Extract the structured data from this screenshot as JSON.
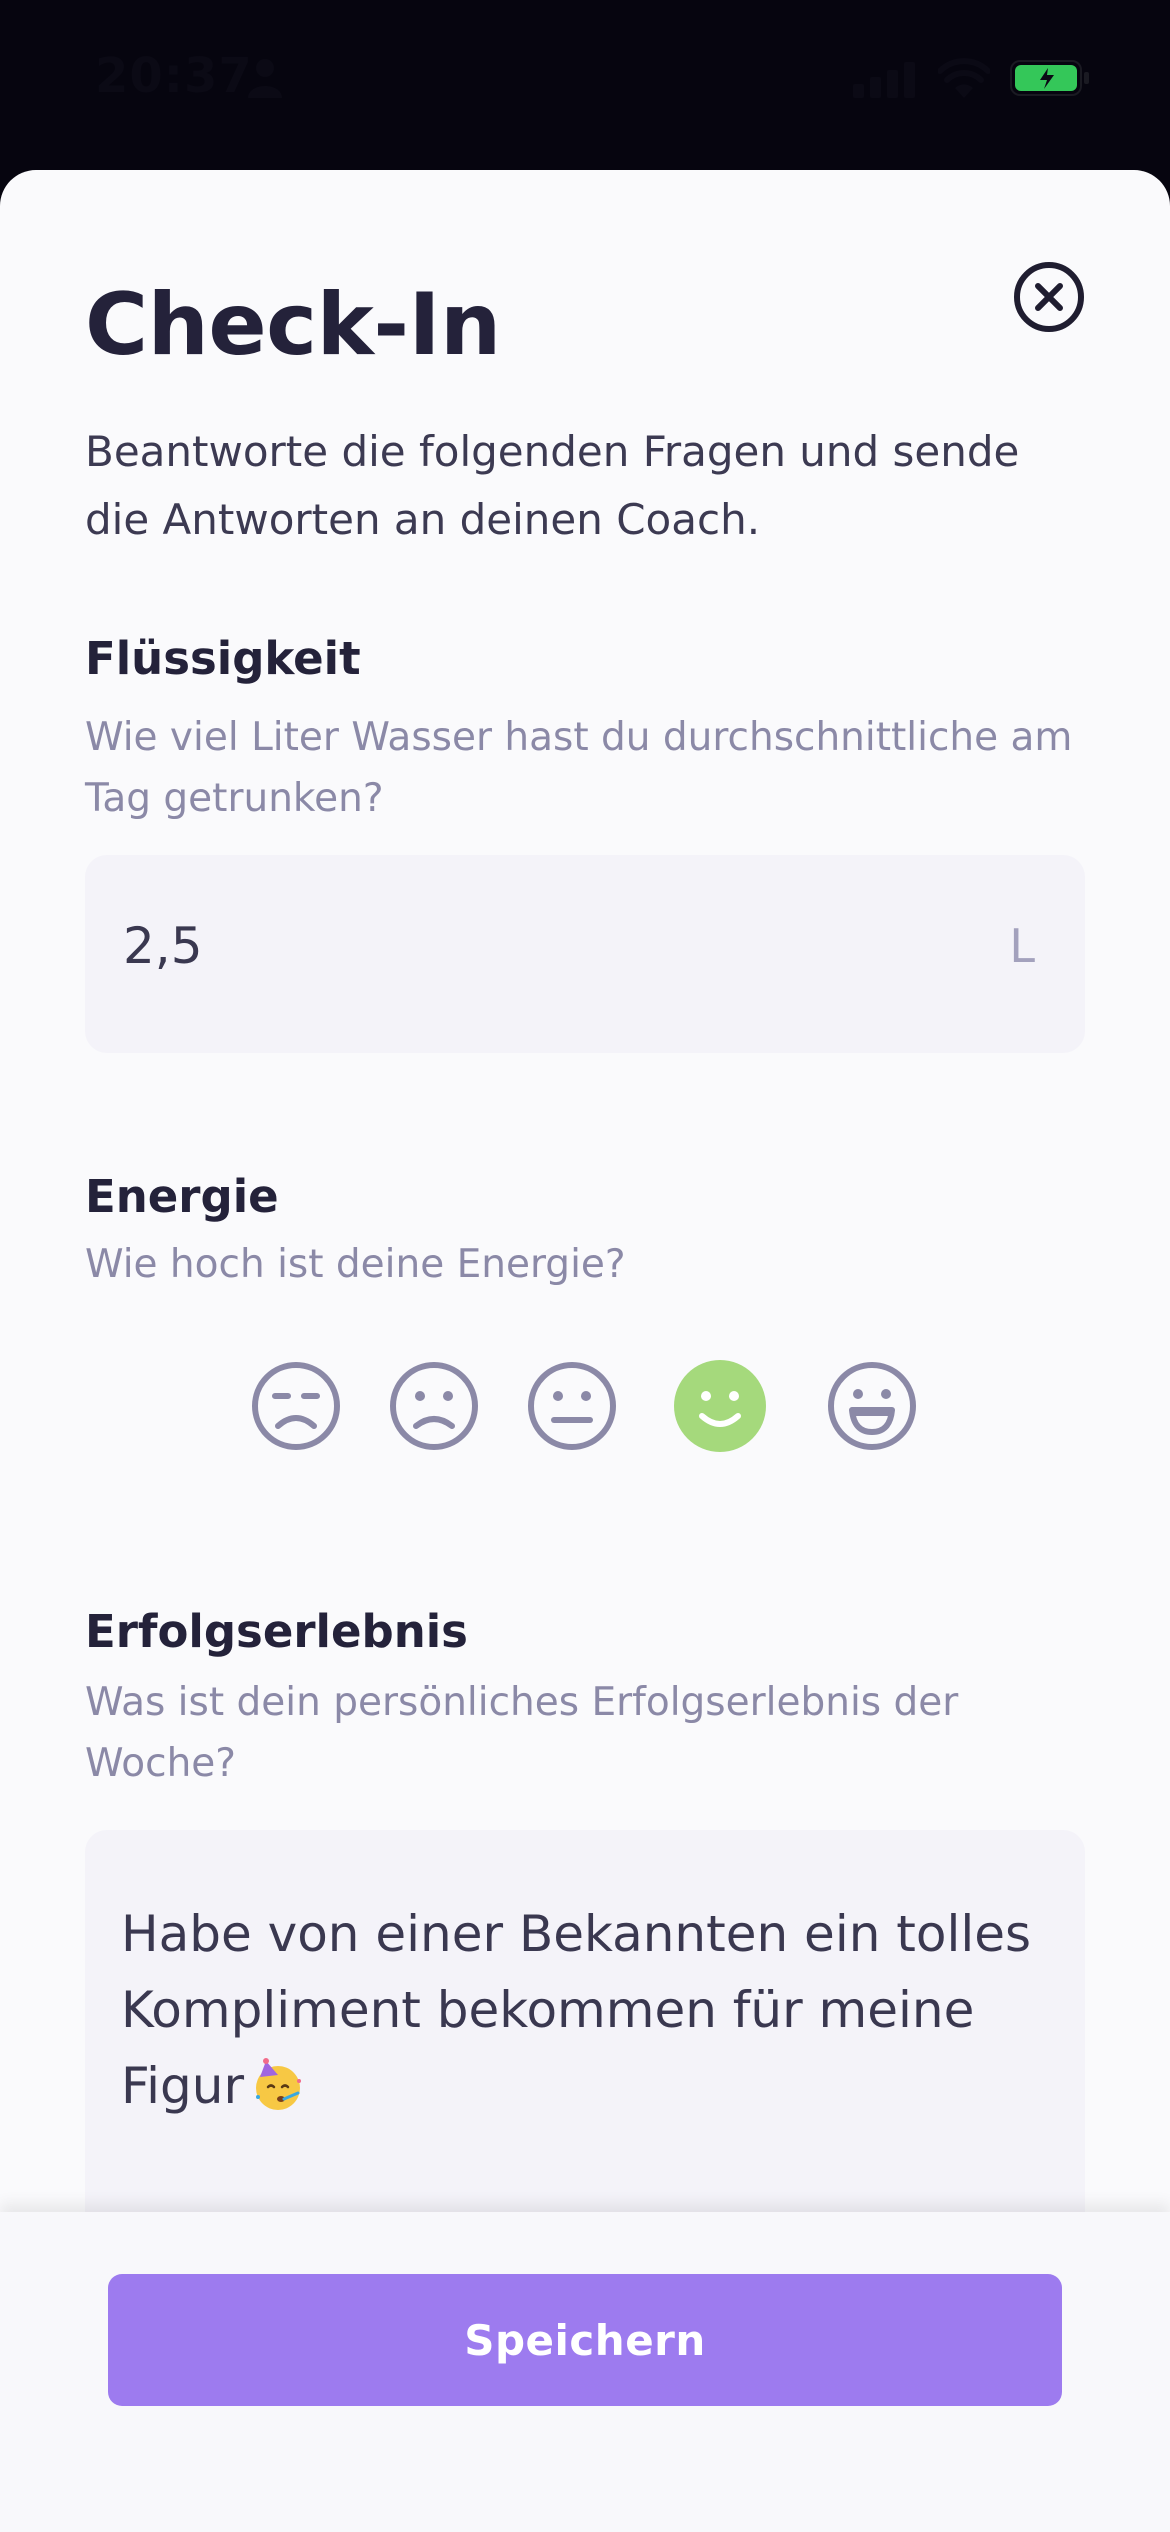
{
  "status_bar": {
    "time": "20:37",
    "battery_color": "#34c759"
  },
  "sheet": {
    "title": "Check-In",
    "intro": "Beantworte die folgenden Fragen und sende die Antworten an deinen Coach.",
    "close_icon": "close-circle-icon"
  },
  "fluid": {
    "label": "Flüssigkeit",
    "hint": "Wie viel Liter Wasser hast du durchschnittliche am Tag getrunken?",
    "value": "2,5",
    "unit": "L"
  },
  "energy": {
    "label": "Energie",
    "hint": "Wie hoch ist deine Energie?",
    "options": [
      "very-sad-face-icon",
      "sad-face-icon",
      "neutral-face-icon",
      "happy-face-icon",
      "very-happy-face-icon"
    ],
    "selected_index": 3,
    "selected_color": "#a5d97c",
    "default_color": "#8b89a7"
  },
  "success": {
    "label": "Erfolgserlebnis",
    "hint": "Was ist dein persönliches Erfolgserlebnis der Woche?",
    "value": "Habe von einer Bekannten ein tolles Kompliment bekommen für meine Figur",
    "emoji": "partying-face-icon"
  },
  "footer": {
    "save_label": "Speichern",
    "accent": "#9d7bef"
  }
}
